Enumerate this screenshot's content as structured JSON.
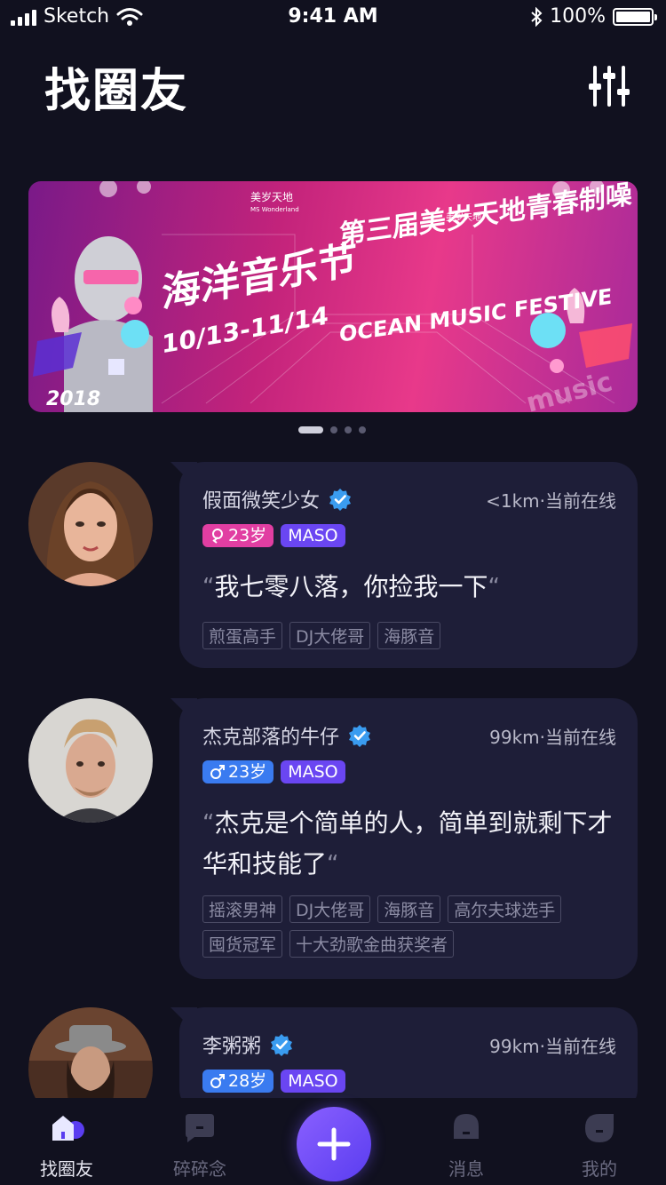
{
  "status_bar": {
    "carrier": "Sketch",
    "time": "9:41 AM",
    "battery": "100%"
  },
  "header": {
    "title": "找圈友"
  },
  "banner": {
    "brand": "美岁天地",
    "brand_en": "MS Wonderland",
    "title": "海洋音乐节",
    "subtitle": "第三届美岁天地青春制噪",
    "dates": "10/13-11/14",
    "english": "OCEAN MUSIC FESTIVE",
    "year": "2018",
    "music_text": "music",
    "page_count": 4,
    "active_page": 0
  },
  "users": [
    {
      "name": "假面微笑少女",
      "distance": "<1km·当前在线",
      "gender": "female",
      "age": "23岁",
      "level": "MASO",
      "quote": "我七零八落，你捡我一下",
      "tags": [
        "煎蛋高手",
        "DJ大佬哥",
        "海豚音"
      ]
    },
    {
      "name": "杰克部落的牛仔",
      "distance": "99km·当前在线",
      "gender": "male",
      "age": "23岁",
      "level": "MASO",
      "quote": "杰克是个简单的人，简单到就剩下才华和技能了",
      "tags": [
        "摇滚男神",
        "DJ大佬哥",
        "海豚音",
        "高尔夫球选手",
        "囤货冠军",
        "十大劲歌金曲获奖者"
      ]
    },
    {
      "name": "李粥粥",
      "distance": "99km·当前在线",
      "gender": "male",
      "age": "28岁",
      "level": "MASO",
      "quote": "",
      "tags": []
    }
  ],
  "tabbar": {
    "items": [
      {
        "label": "找圈友",
        "icon": "home-icon",
        "active": true
      },
      {
        "label": "碎碎念",
        "icon": "chat-bubble-icon",
        "active": false
      },
      {
        "label": "",
        "icon": "plus-icon",
        "active": false
      },
      {
        "label": "消息",
        "icon": "message-bell-icon",
        "active": false
      },
      {
        "label": "我的",
        "icon": "profile-leaf-icon",
        "active": false
      }
    ]
  },
  "colors": {
    "background": "#11111f",
    "card": "#1e1e38",
    "female_badge": "#e13ea2",
    "male_badge": "#3a7bf0",
    "level_badge": "#6a46f2",
    "verified": "#3a9cf0",
    "accent": "#6a46f2"
  }
}
